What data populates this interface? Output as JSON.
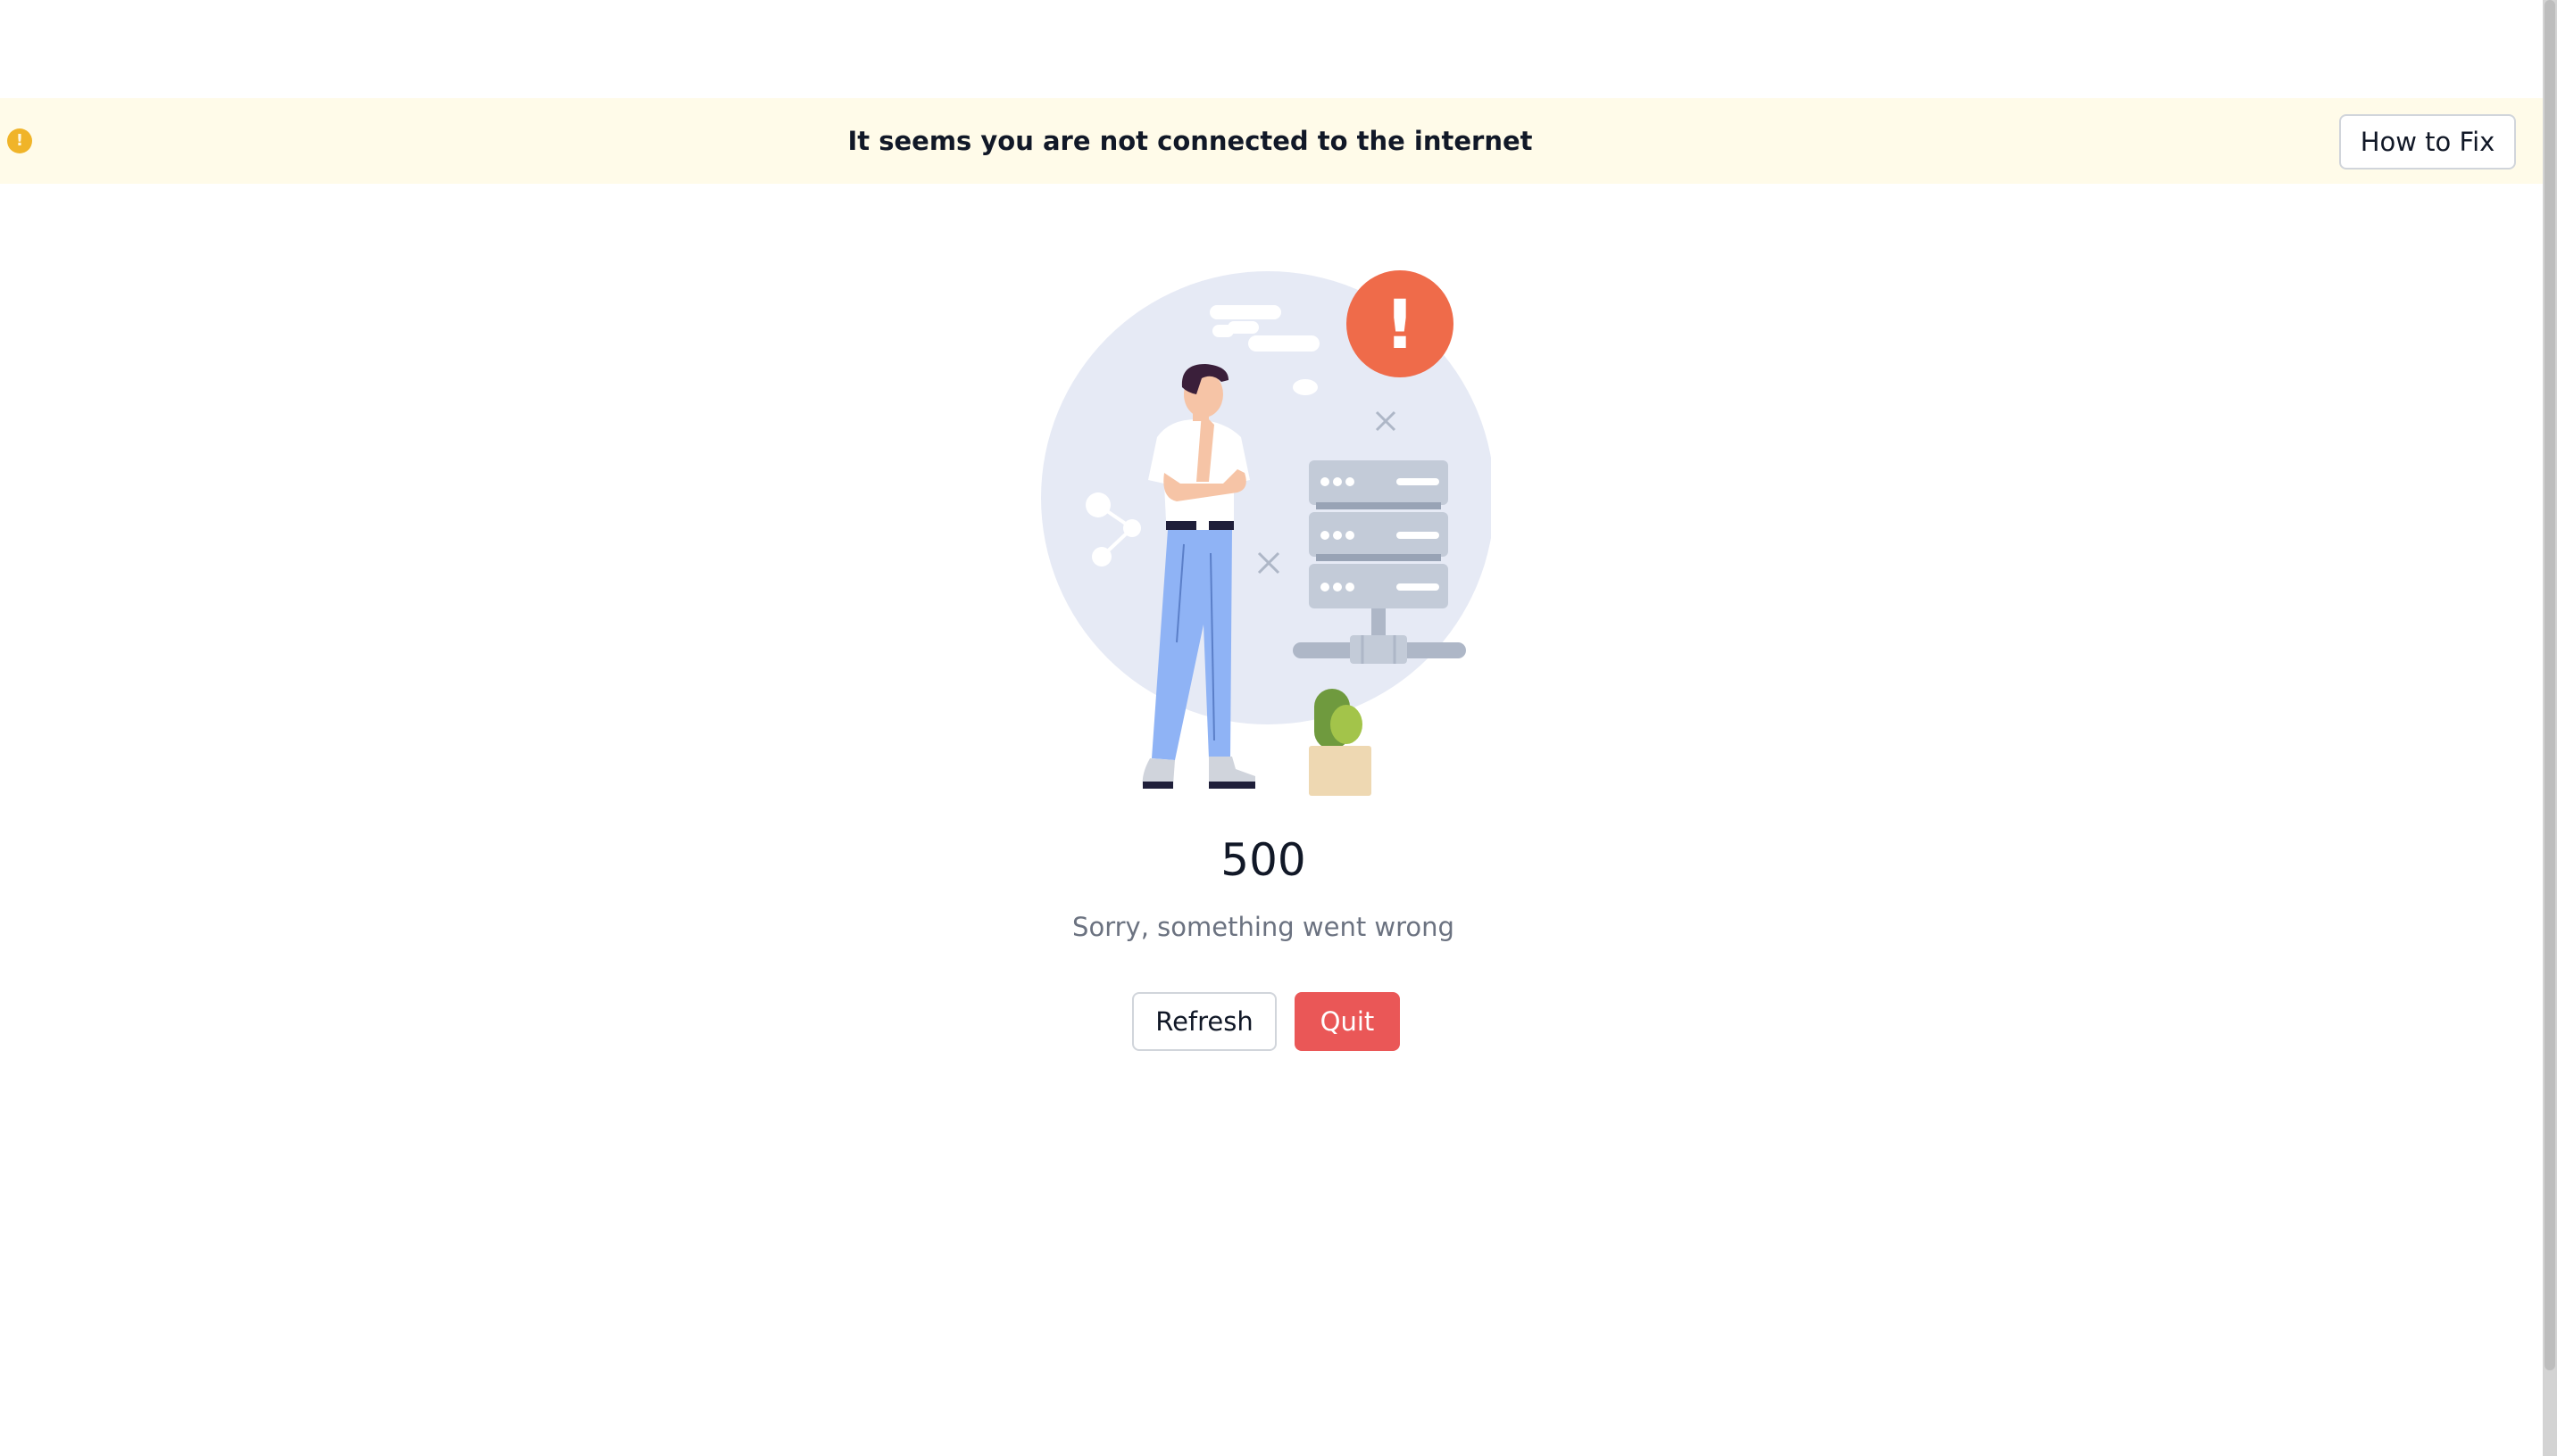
{
  "banner": {
    "message": "It seems you are not connected to the internet",
    "fix_label": "How to Fix",
    "icon": "warning-icon",
    "icon_glyph": "!",
    "background_color": "#fffbe9",
    "icon_color": "#f0b429"
  },
  "error": {
    "code": "500",
    "message": "Sorry, something went wrong",
    "illustration": "server-error-illustration",
    "badge_glyph": "!"
  },
  "actions": {
    "refresh_label": "Refresh",
    "quit_label": "Quit"
  },
  "colors": {
    "quit": "#ea5757",
    "alert_badge": "#ef6b4a",
    "circle": "#e6eaf5"
  }
}
